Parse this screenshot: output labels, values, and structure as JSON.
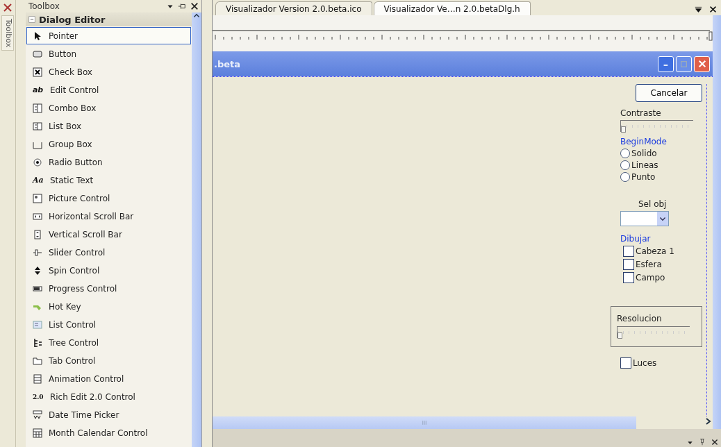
{
  "side_tab": {
    "label": "Toolbox"
  },
  "toolbox": {
    "title": "Toolbox",
    "group": {
      "label": "Dialog Editor",
      "expanded": true
    },
    "items": [
      {
        "label": "Pointer",
        "selected": true
      },
      {
        "label": "Button",
        "selected": false
      },
      {
        "label": "Check Box",
        "selected": false
      },
      {
        "label": "Edit Control",
        "selected": false,
        "icon_text": "ab"
      },
      {
        "label": "Combo Box",
        "selected": false
      },
      {
        "label": "List Box",
        "selected": false
      },
      {
        "label": "Group Box",
        "selected": false
      },
      {
        "label": "Radio Button",
        "selected": false
      },
      {
        "label": "Static Text",
        "selected": false,
        "icon_text": "Aa"
      },
      {
        "label": "Picture Control",
        "selected": false
      },
      {
        "label": "Horizontal Scroll Bar",
        "selected": false
      },
      {
        "label": "Vertical Scroll Bar",
        "selected": false
      },
      {
        "label": "Slider Control",
        "selected": false
      },
      {
        "label": "Spin Control",
        "selected": false
      },
      {
        "label": "Progress Control",
        "selected": false
      },
      {
        "label": "Hot Key",
        "selected": false
      },
      {
        "label": "List Control",
        "selected": false
      },
      {
        "label": "Tree Control",
        "selected": false
      },
      {
        "label": "Tab Control",
        "selected": false
      },
      {
        "label": "Animation Control",
        "selected": false
      },
      {
        "label": "Rich Edit 2.0 Control",
        "selected": false,
        "icon_text": "2.0"
      },
      {
        "label": "Date Time Picker",
        "selected": false
      },
      {
        "label": "Month Calendar Control",
        "selected": false
      }
    ]
  },
  "tabs": [
    {
      "label": "Visualizador Version 2.0.beta.ico",
      "selected": false
    },
    {
      "label": "Visualizador Ve…n 2.0.betaDlg.h",
      "selected": true
    }
  ],
  "dialog": {
    "title": ".beta",
    "cancel_button": "Cancelar",
    "contrast": {
      "label": "Contraste",
      "level": 0
    },
    "begin_mode": {
      "label": "BeginMode",
      "options": [
        {
          "label": "Solido",
          "selected": false
        },
        {
          "label": "Lineas",
          "selected": false
        },
        {
          "label": "Punto",
          "selected": false
        }
      ]
    },
    "select_object": {
      "label": "Sel obj"
    },
    "draw": {
      "label": "Dibujar",
      "options": [
        {
          "label": "Cabeza 1",
          "checked": false
        },
        {
          "label": "Esfera",
          "checked": false
        },
        {
          "label": "Campo",
          "checked": false
        }
      ]
    },
    "resolution": {
      "label": "Resolucion",
      "level": 0
    },
    "lights": {
      "label": "Luces",
      "checked": false
    }
  }
}
